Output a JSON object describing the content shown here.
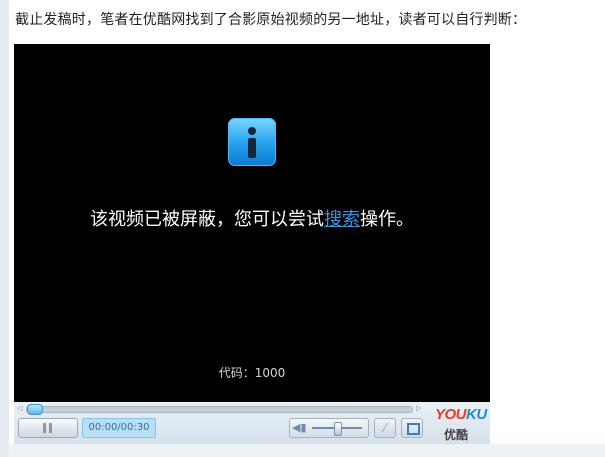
{
  "article": {
    "caption": "截止发稿时，笔者在优酷网找到了合影原始视频的另一地址，读者可以自行判断："
  },
  "player": {
    "message_before": "该视频已被屏蔽，您可以尝试",
    "search_link": "搜索",
    "message_after": "操作。",
    "error_code": "代码：1000",
    "time": "00:00/00:30",
    "logo_en_you": "YOU",
    "logo_en_ku": "KU",
    "logo_cn": "优酷",
    "info_icon": "info-icon",
    "accent_color": "#3d8fe6"
  }
}
